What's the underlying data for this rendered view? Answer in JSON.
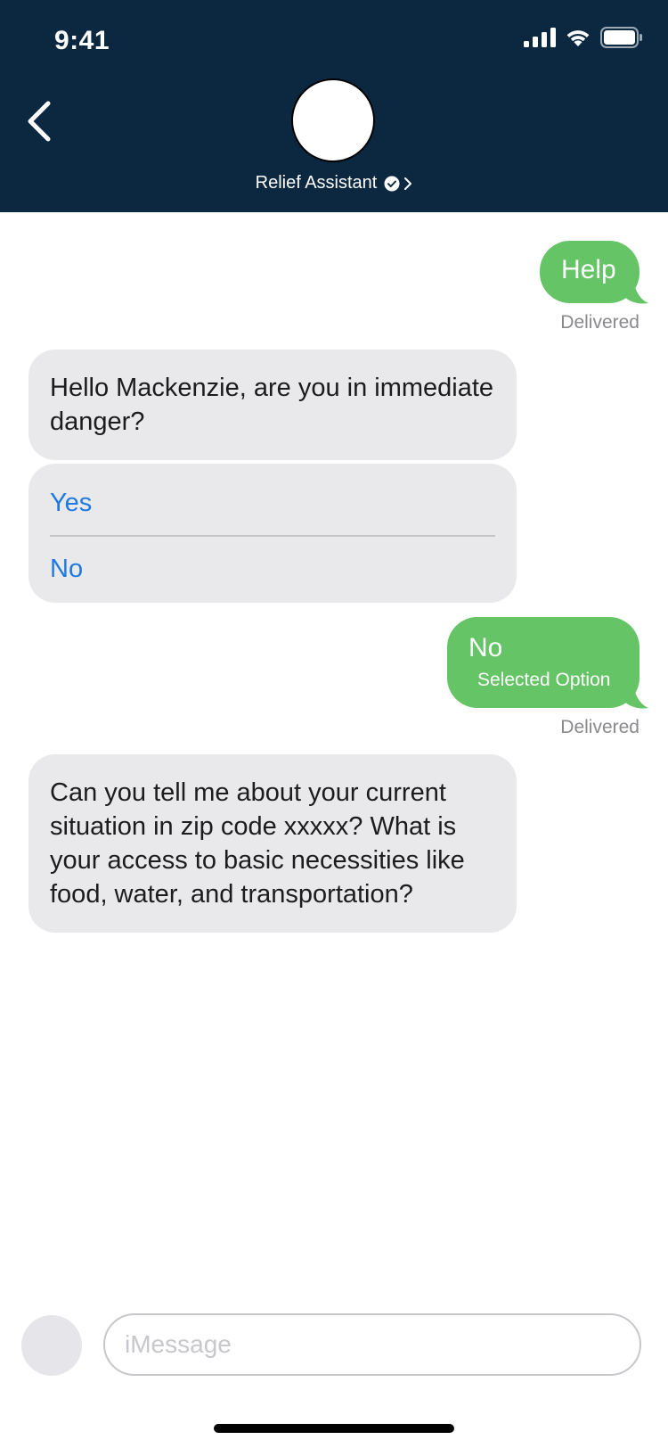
{
  "status_bar": {
    "time": "9:41"
  },
  "header": {
    "contact_name": "Relief Assistant"
  },
  "messages": {
    "outgoing_1": {
      "text": "Help",
      "status": "Delivered"
    },
    "incoming_1": {
      "text": "Hello Mackenzie, are you in immediate danger?"
    },
    "options": [
      "Yes",
      "No"
    ],
    "outgoing_2": {
      "text": "No",
      "subtext": "Selected Option",
      "status": "Delivered"
    },
    "incoming_2": {
      "text": "Can you tell me about your current situation in zip code xxxxx? What is your access to basic necessities like food, water, and transportation?"
    }
  },
  "composer": {
    "placeholder": "iMessage"
  },
  "colors": {
    "header_bg": "#0b2840",
    "outgoing_bubble": "#65c466",
    "incoming_bubble": "#e9e9eb",
    "option_link": "#1f7ae0"
  }
}
